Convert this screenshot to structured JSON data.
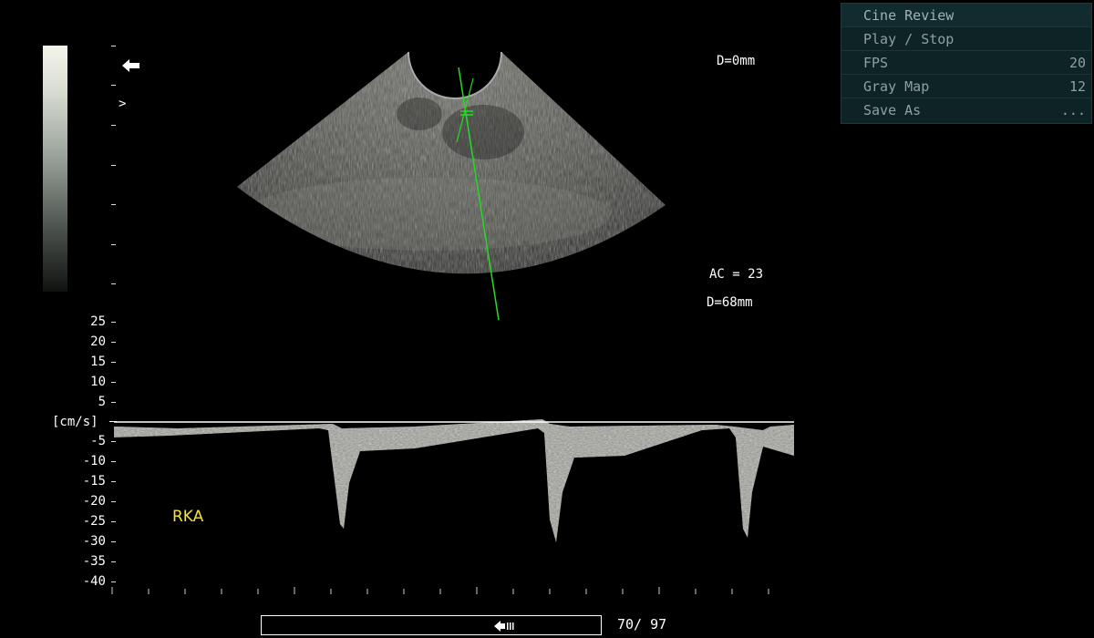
{
  "cine_menu": {
    "title": "Cine Review",
    "items": [
      {
        "label": "Play / Stop",
        "value": ""
      },
      {
        "label": "FPS",
        "value": "20"
      },
      {
        "label": "Gray Map",
        "value": "12"
      },
      {
        "label": "Save As",
        "value": "..."
      }
    ]
  },
  "image_info": {
    "depth_top": "D=0mm",
    "ac": "AC = 23",
    "depth_bottom": "D=68mm",
    "focus_marker": ">"
  },
  "doppler": {
    "unit": "[cm/s]",
    "scale_labels": [
      "25",
      "20",
      "15",
      "10",
      "5",
      "-5",
      "-10",
      "-15",
      "-20",
      "-25",
      "-30",
      "-35",
      "-40"
    ],
    "annotation": "RKA"
  },
  "cine": {
    "frame_counter": "70/ 97",
    "colors": {
      "annotation": "#f2e23a",
      "cursor_line": "#22dd22",
      "menu_bg": "#0e2326"
    }
  }
}
